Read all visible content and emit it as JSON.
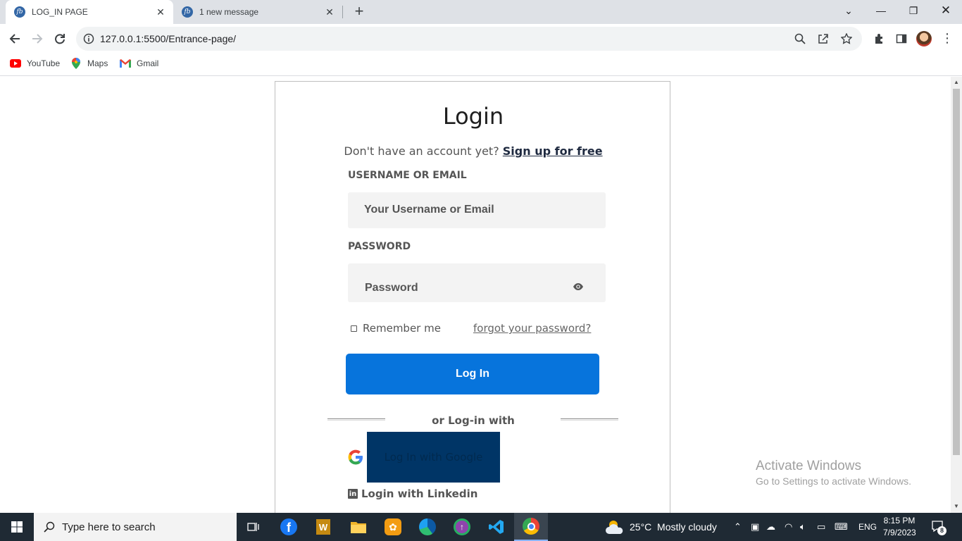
{
  "browser": {
    "tabs": [
      {
        "title": "LOG_IN PAGE",
        "active": true
      },
      {
        "title": "1 new message",
        "active": false
      }
    ],
    "url": "127.0.0.1:5500/Entrance-page/",
    "bookmarks": [
      "YouTube",
      "Maps",
      "Gmail"
    ]
  },
  "login": {
    "title": "Login",
    "signup_prompt": "Don't have an account yet?",
    "signup_link": "Sign up for free",
    "username_label": "USERNAME OR EMAIL",
    "username_placeholder": "Your Username or Email",
    "password_label": "PASSWORD",
    "password_placeholder": "Password",
    "remember_label": "Remember me",
    "forgot_link": "forgot your password?",
    "login_button": "Log In",
    "or_text": "or Log-in with",
    "google_button": "Log In with Google",
    "linkedin_text": "Login with Linkedin",
    "button_color": "#0774dc",
    "google_button_color": "#003566"
  },
  "watermark": {
    "title": "Activate Windows",
    "subtitle": "Go to Settings to activate Windows."
  },
  "taskbar": {
    "search_placeholder": "Type here to search",
    "weather": "25°C  Mostly cloudy",
    "language": "ENG",
    "time": "8:15 PM",
    "date": "7/9/2023",
    "notification_count": "8"
  }
}
